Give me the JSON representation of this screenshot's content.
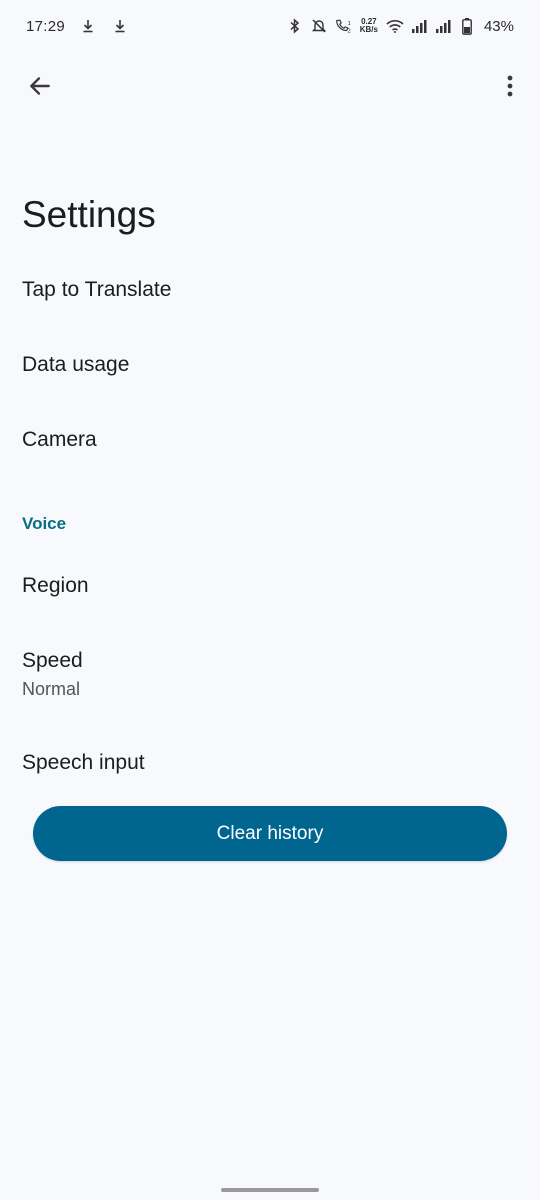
{
  "status_bar": {
    "time": "17:29",
    "speed_value": "0.27",
    "speed_unit": "KB/s",
    "battery_percent": "43%",
    "icons": [
      "download-icon",
      "download-icon",
      "bluetooth-icon",
      "mute-icon",
      "call-icon",
      "wifi-icon",
      "signal-icon",
      "signal-icon",
      "battery-icon"
    ]
  },
  "header": {
    "back_icon": "arrow-left-icon",
    "more_icon": "more-vert-icon"
  },
  "page": {
    "title": "Settings"
  },
  "items": {
    "tap_to_translate": "Tap to Translate",
    "data_usage": "Data usage",
    "camera": "Camera",
    "voice_header": "Voice",
    "region": "Region",
    "speed": "Speed",
    "speed_value": "Normal",
    "speech_input": "Speech input"
  },
  "actions": {
    "clear_history": "Clear history"
  },
  "colors": {
    "accent": "#0b6d85",
    "button": "#00658f",
    "background": "#f8f9fc"
  }
}
